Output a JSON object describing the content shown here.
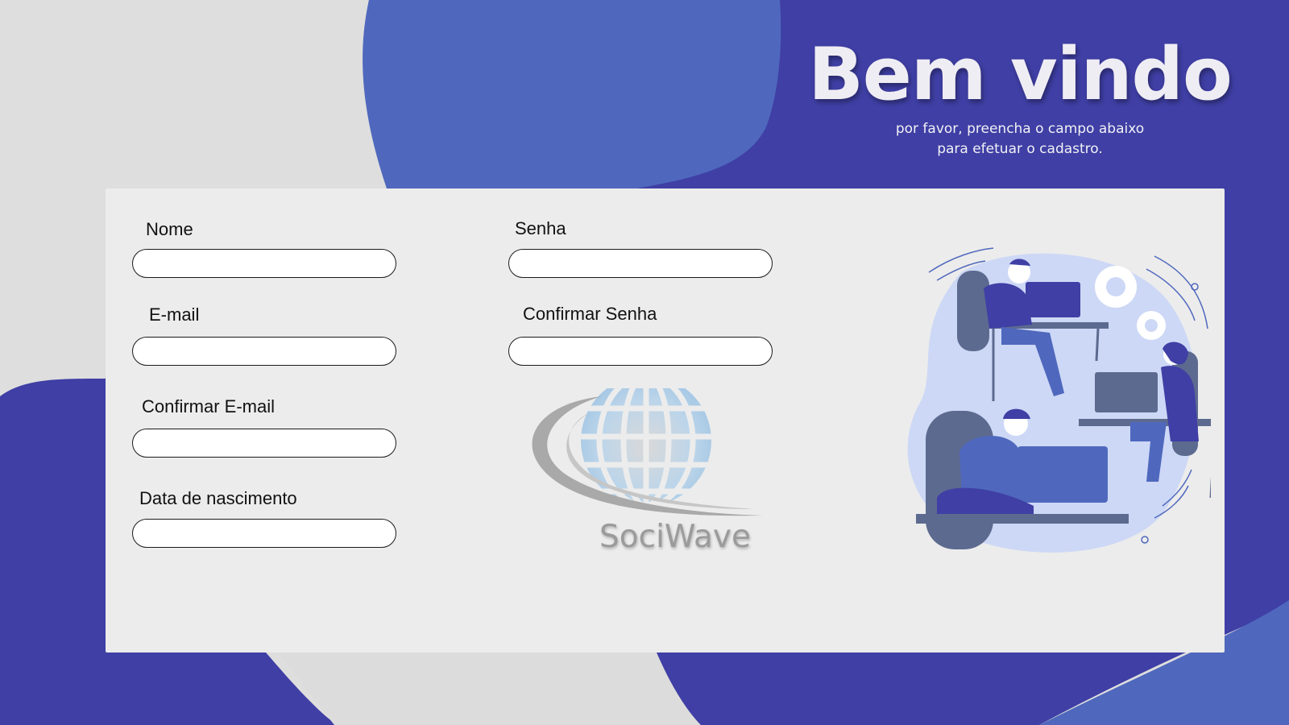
{
  "colors": {
    "background": "#dedede",
    "primary_blue": "#3f3fa5",
    "accent_blue": "#4f68bd",
    "panel": "#ececec"
  },
  "header": {
    "title": "Bem vindo",
    "subtitle_line1": "por favor, preencha o campo abaixo",
    "subtitle_line2": "para efetuar o cadastro."
  },
  "form": {
    "nome": {
      "label": "Nome",
      "value": ""
    },
    "email": {
      "label": "E-mail",
      "value": ""
    },
    "confirmar_email": {
      "label": "Confirmar E-mail",
      "value": ""
    },
    "data_nascimento": {
      "label": "Data de nascimento",
      "value": ""
    },
    "senha": {
      "label": "Senha",
      "value": ""
    },
    "confirmar_senha": {
      "label": "Confirmar Senha",
      "value": ""
    }
  },
  "logo": {
    "text": "SociWave",
    "icon": "globe-swoosh-logo"
  },
  "illustration": {
    "icon": "people-working-at-computers-illustration"
  }
}
